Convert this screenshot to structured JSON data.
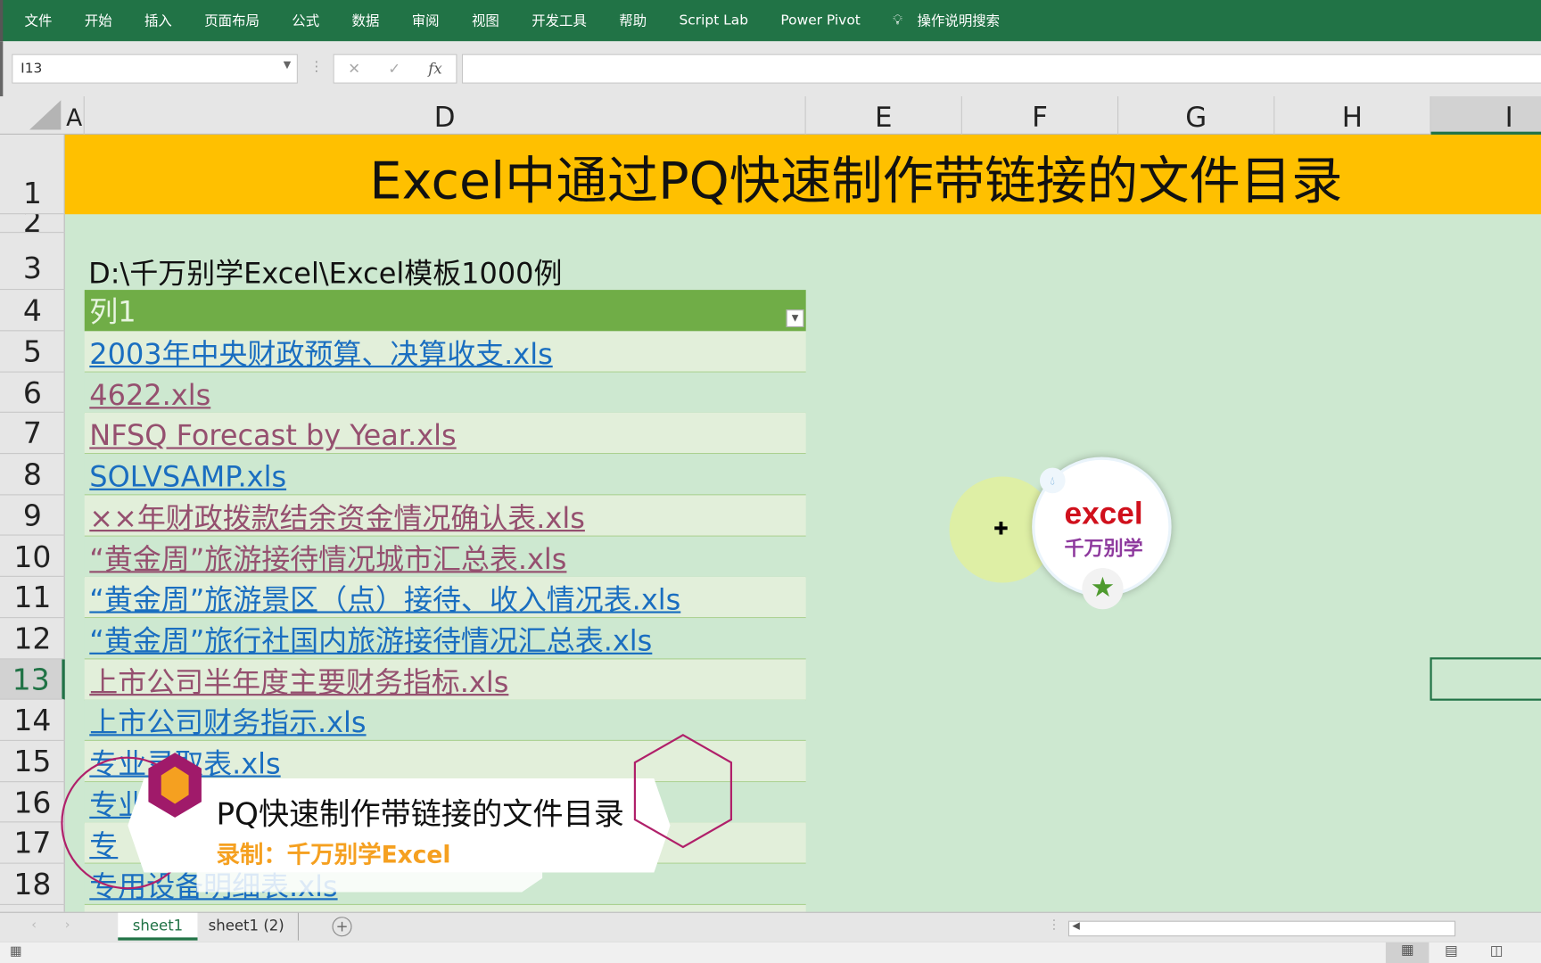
{
  "ribbon": {
    "tabs": [
      "文件",
      "开始",
      "插入",
      "页面布局",
      "公式",
      "数据",
      "审阅",
      "视图",
      "开发工具",
      "帮助",
      "Script Lab",
      "Power Pivot"
    ],
    "search": "操作说明搜索"
  },
  "formula_bar": {
    "name_box": "I13",
    "cancel": "✕",
    "enter": "✓",
    "fx": "fx",
    "value": ""
  },
  "columns": [
    "A",
    "D",
    "E",
    "F",
    "G",
    "H",
    "I"
  ],
  "rows": [
    "1",
    "2",
    "3",
    "4",
    "5",
    "6",
    "7",
    "8",
    "9",
    "10",
    "11",
    "12",
    "13",
    "14",
    "15",
    "16",
    "17",
    "18"
  ],
  "sheet": {
    "title": "Excel中通过PQ快速制作带链接的文件目录",
    "path": "D:\\千万别学Excel\\Excel模板1000例",
    "table_header": "列1",
    "files": [
      {
        "name": "2003年中央财政预算、决算收支.xls",
        "visited": false
      },
      {
        "name": "4622.xls",
        "visited": true
      },
      {
        "name": "NFSQ Forecast  by Year.xls",
        "visited": true
      },
      {
        "name": "SOLVSAMP.xls",
        "visited": false
      },
      {
        "name": "××年财政拨款结余资金情况确认表.xls",
        "visited": true
      },
      {
        "name": "“黄金周”旅游接待情况城市汇总表.xls",
        "visited": true
      },
      {
        "name": "“黄金周”旅游景区（点）接待、收入情况表.xls",
        "visited": false
      },
      {
        "name": "“黄金周”旅行社国内旅游接待情况汇总表.xls",
        "visited": false
      },
      {
        "name": "上市公司半年度主要财务指标.xls",
        "visited": true
      },
      {
        "name": "上市公司财务指示.xls",
        "visited": false
      },
      {
        "name": "专业录取表.xls",
        "visited": false
      },
      {
        "name": "专业",
        "visited": false
      },
      {
        "name": "专",
        "visited": false
      },
      {
        "name": "专用设备明细表.xls",
        "visited": false
      }
    ]
  },
  "overlay": {
    "title": "PQ快速制作带链接的文件目录",
    "subtitle": "录制：千万别学Excel",
    "logo_text": "excel",
    "logo_sub": "千万别学"
  },
  "sheet_tabs": [
    "sheet1",
    "sheet1 (2)"
  ],
  "colors": {
    "ribbon": "#217346",
    "title_bg": "#ffc000",
    "table_header": "#70ad47",
    "link": "#1a6ec0",
    "visited_link": "#95506f",
    "accent": "#c2185b"
  }
}
